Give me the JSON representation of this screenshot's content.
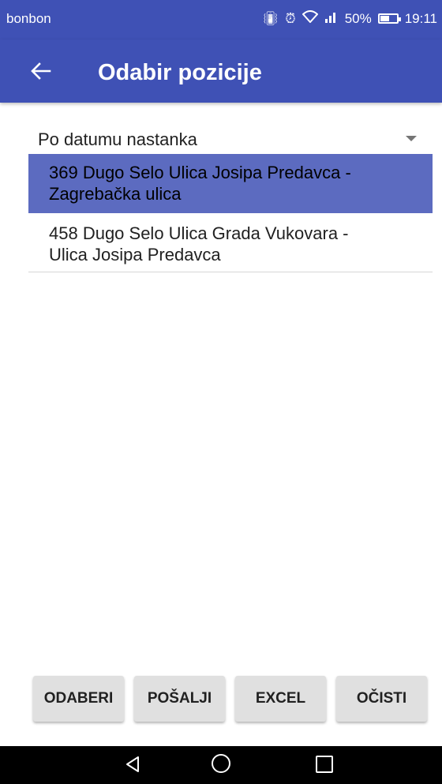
{
  "status_bar": {
    "carrier": "bonbon",
    "icons": [
      "vibrate-icon",
      "alarm-icon",
      "wifi-icon",
      "signal-icon",
      "battery-icon"
    ],
    "battery": "50%",
    "time": "19:11"
  },
  "app_bar": {
    "title": "Odabir pozicije",
    "background": "#3f51b5"
  },
  "sort_spinner": {
    "selected": "Po datumu nastanka"
  },
  "list": {
    "items": [
      {
        "line1": "369 Dugo Selo Ulica Josipa Predavca -",
        "line2": "Zagrebačka  ulica",
        "selected": true
      },
      {
        "line1": "458 Dugo Selo Ulica Grada Vukovara -",
        "line2": "Ulica Josipa Predavca",
        "selected": false
      }
    ],
    "selected_color": "#5c6bc0"
  },
  "buttons": {
    "select": "ODABERI",
    "send": "POŠALJI",
    "excel": "EXCEL",
    "clear": "OČISTI"
  }
}
